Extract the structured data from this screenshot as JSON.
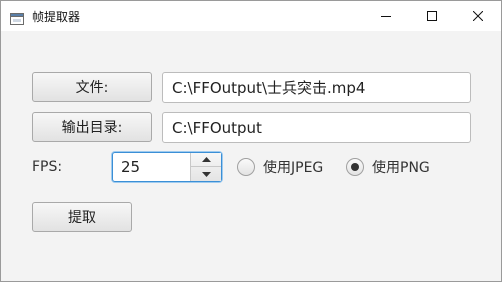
{
  "window": {
    "title": "帧提取器",
    "controls": {
      "minimize": "minimize-icon",
      "maximize": "maximize-icon",
      "close": "close-icon"
    }
  },
  "form": {
    "file_button_label": "文件:",
    "file_path": "C:\\FFOutput\\士兵突击.mp4",
    "output_button_label": "输出目录:",
    "output_path": "C:\\FFOutput",
    "fps_label": "FPS:",
    "fps_value": "25",
    "radio_jpeg_label": "使用JPEG",
    "radio_png_label": "使用PNG",
    "selected_format": "PNG",
    "extract_button_label": "提取"
  },
  "colors": {
    "focus_border": "#3b8fd6",
    "window_bg": "#f3f3f3"
  }
}
